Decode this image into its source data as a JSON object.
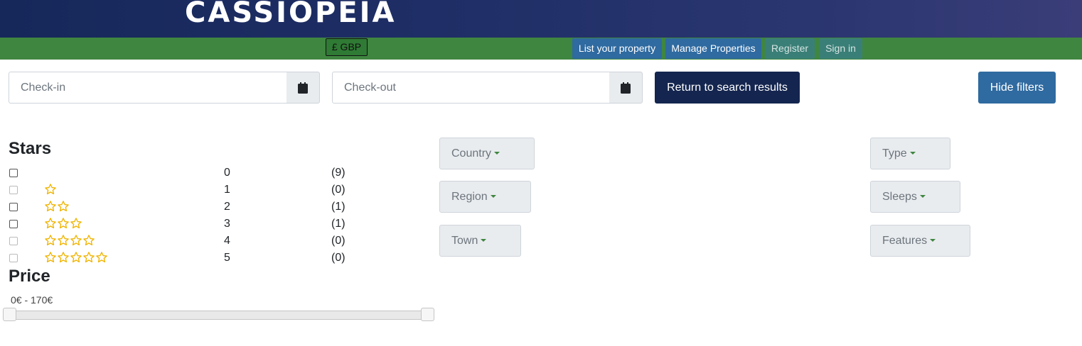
{
  "header": {
    "brand": "CASSIOPEIA",
    "currency": "£ GBP"
  },
  "nav": {
    "list_property": "List your property",
    "manage_properties": "Manage Properties",
    "register": "Register",
    "sign_in": "Sign in"
  },
  "search": {
    "checkin_placeholder": "Check-in",
    "checkout_placeholder": "Check-out",
    "return_label": "Return to search results",
    "hide_filters_label": "Hide filters"
  },
  "filters": {
    "stars_heading": "Stars",
    "stars": [
      {
        "value": "0",
        "count": "(9)",
        "stars": 0,
        "enabled": true
      },
      {
        "value": "1",
        "count": "(0)",
        "stars": 1,
        "enabled": false
      },
      {
        "value": "2",
        "count": "(1)",
        "stars": 2,
        "enabled": true
      },
      {
        "value": "3",
        "count": "(1)",
        "stars": 3,
        "enabled": true
      },
      {
        "value": "4",
        "count": "(0)",
        "stars": 4,
        "enabled": false
      },
      {
        "value": "5",
        "count": "(0)",
        "stars": 5,
        "enabled": false
      }
    ],
    "price_heading": "Price",
    "price_range": "0€ - 170€",
    "dropdowns": {
      "country": "Country",
      "region": "Region",
      "town": "Town",
      "type": "Type",
      "sleeps": "Sleeps",
      "features": "Features"
    }
  },
  "colors": {
    "header_navy": "#16285a",
    "nav_green": "#3f8640",
    "primary_blue": "#2f6aa0",
    "star_gold": "#f0b400"
  }
}
